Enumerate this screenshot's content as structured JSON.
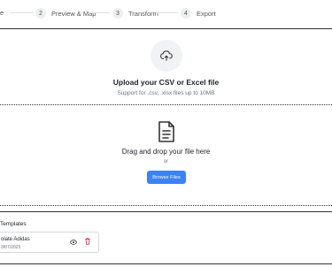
{
  "stepper": {
    "cut_label": "e",
    "steps": [
      {
        "num": "2",
        "label": "Preview & Map"
      },
      {
        "num": "3",
        "label": "Transform"
      },
      {
        "num": "4",
        "label": "Export"
      }
    ]
  },
  "upload": {
    "icon": "cloud-upload-icon",
    "title": "Upload your CSV or Excel file",
    "subtitle": "Support for .csv, .xlsx files up to 10MB"
  },
  "dropzone": {
    "icon": "document-icon",
    "title": "Drag and drop your file here",
    "or": "or",
    "browse_label": "Browse Files",
    "accent": "#3b82f6"
  },
  "templates": {
    "title": "Templates",
    "items": [
      {
        "name": "olate Adidas",
        "date": "3/07/2025",
        "view_icon": "eye-icon",
        "delete_icon": "trash-icon"
      }
    ]
  }
}
